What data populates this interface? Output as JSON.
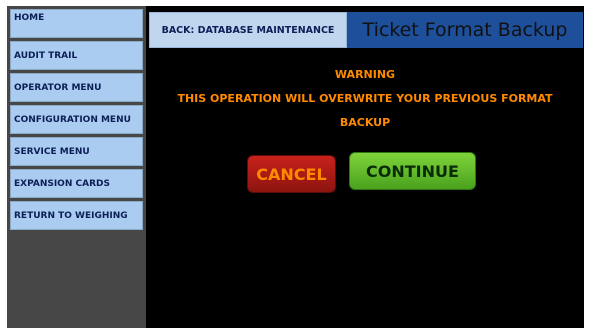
{
  "sidebar": {
    "items": [
      {
        "label": "HOME"
      },
      {
        "label": "AUDIT TRAIL"
      },
      {
        "label": "OPERATOR MENU"
      },
      {
        "label": "CONFIGURATION MENU"
      },
      {
        "label": "SERVICE MENU"
      },
      {
        "label": "EXPANSION CARDS"
      },
      {
        "label": "RETURN TO WEIGHING"
      }
    ]
  },
  "header": {
    "back_label": "BACK: DATABASE MAINTENANCE",
    "title": "Ticket Format Backup"
  },
  "dialog": {
    "warning_title": "WARNING",
    "warning_line1": "THIS OPERATION WILL OVERWRITE YOUR PREVIOUS FORMAT",
    "warning_line2": "BACKUP",
    "cancel_label": "CANCEL",
    "continue_label": "CONTINUE"
  },
  "colors": {
    "sidebar_button": "#a9ccf0",
    "title_bar": "#1d4f9a",
    "warning_text": "#ff8a00",
    "cancel_button": "#c8221a",
    "continue_button": "#7fd43a",
    "background": "#000000"
  }
}
